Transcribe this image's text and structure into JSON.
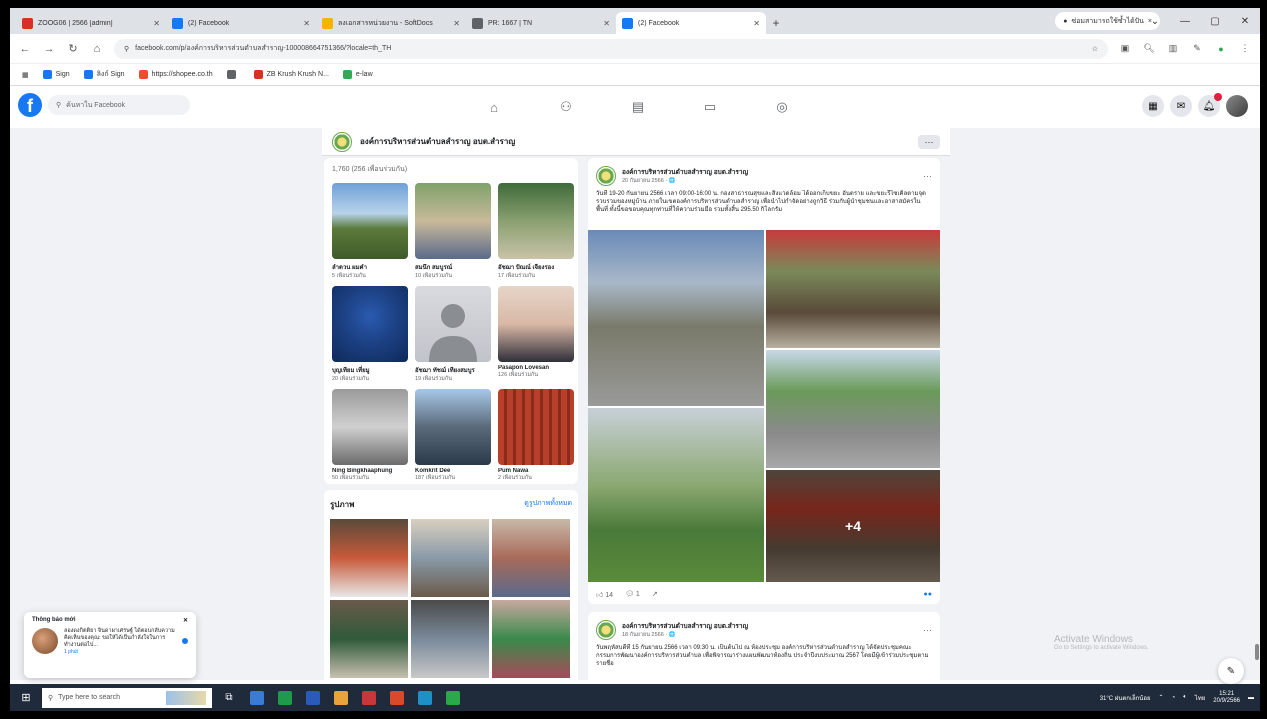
{
  "browser": {
    "tabs": [
      {
        "title": "ZOOG06 | 2566 [admin]",
        "color": "#d93025",
        "active": false
      },
      {
        "title": "(2) Facebook",
        "color": "#1877f2",
        "active": false
      },
      {
        "title": "ลงเอกสารหน่วยงาน - SoftDocs",
        "color": "#f4b400",
        "active": false
      },
      {
        "title": "PR: 1667 | TN",
        "color": "#5f6368",
        "active": false
      },
      {
        "title": "(2) Facebook",
        "color": "#1877f2",
        "active": true
      }
    ],
    "new_tab": "+",
    "profile_pill": "ซ่อมสามารถใช้ซ้ำได้ปัน",
    "url": "facebook.com/p/องค์การบริหารส่วนตำบลสำราญ-100008664751366/?locale=th_TH",
    "bookmarks": [
      {
        "label": "Sign",
        "color": "#1877f2"
      },
      {
        "label": "ลิงก์ Sign",
        "color": "#1877f2"
      },
      {
        "label": "https://shopee.co.th",
        "color": "#ee4d2d"
      },
      {
        "label": "",
        "color": "#5f6368"
      },
      {
        "label": "ZB Krush Krush N...",
        "color": "#d93025"
      },
      {
        "label": "e-law",
        "color": "#34a853"
      }
    ]
  },
  "facebook": {
    "search_placeholder": "ค้นหาใน Facebook",
    "group_name": "องค์การบริหารส่วนตำบลสำราญ อบต.สำราญ",
    "friends_count": "1,760 (256 เพื่อนร่วมกัน)",
    "friends": [
      {
        "name": "ลำดวน ผมคำ",
        "mutual": "5 เพื่อนร่วมกัน",
        "bg": "linear-gradient(180deg,#6fa0d8 0%,#b8d3ea 40%,#5b7a3a 60%,#3f5a2a 100%)"
      },
      {
        "name": "สมนึก สมบูรณ์",
        "mutual": "10 เพื่อนร่วมกัน",
        "bg": "linear-gradient(180deg,#7fa26a 0%,#c9b99a 50%,#5a6a8a 100%)"
      },
      {
        "name": "อัชฌา ปัณณ์ เจียงรอง",
        "mutual": "17 เพื่อนร่วมกัน",
        "bg": "linear-gradient(180deg,#3f6a3a 0%,#8aa070 50%,#c9c3a8 100%)"
      },
      {
        "name": "บุญเทียม เที่ยมู",
        "mutual": "20 เพื่อนร่วมกัน",
        "bg": "radial-gradient(circle at 50% 40%,#2a5ab0 0%,#1b3f80 50%,#0e2a5a 100%)"
      },
      {
        "name": "อัชฌา ทัชฌ์ เทียงสมบูร",
        "mutual": "19 เพื่อนร่วมกัน",
        "bg": "linear-gradient(180deg,#d8dadf 0%,#c0c3c9 100%)"
      },
      {
        "name": "Pasapon Lovesan",
        "mutual": "126 เพื่อนร่วมกัน",
        "bg": "linear-gradient(180deg,#e6d5c8 0%,#d9b8a5 50%,#2f2f3a 100%)"
      },
      {
        "name": "Ning Bingkhaaphung",
        "mutual": "50 เพื่อนร่วมกัน",
        "bg": "linear-gradient(180deg,#9a9a9a 0%,#d0d0d0 50%,#6a6a6a 100%)"
      },
      {
        "name": "Komkrit Dee",
        "mutual": "187 เพื่อนร่วมกัน",
        "bg": "linear-gradient(180deg,#a8c8e8 0%,#5a6a7a 50%,#2a3a4a 100%)"
      },
      {
        "name": "Pum Nawa",
        "mutual": "2 เพื่อนร่วมกัน",
        "bg": "repeating-linear-gradient(90deg,#b8402a 0px,#b8402a 6px,#8a2a1a 6px,#8a2a1a 9px)"
      }
    ],
    "photos_title": "รูปภาพ",
    "photos_link": "ดูรูปภาพทั้งหมด",
    "photos": [
      "linear-gradient(180deg,#5a4a3a,#c85a3a,#e8e8e8)",
      "linear-gradient(180deg,#d8d0c0,#8a9aa8,#6a5a4a)",
      "linear-gradient(180deg,#c8b8a8,#a86a5a,#5a6a8a)",
      "linear-gradient(180deg,#6a5a4a,#2f5a3a,#c8c0b0)",
      "linear-gradient(180deg,#4a4a4a,#7a8a9a,#c8c8c8)",
      "linear-gradient(180deg,#c8a8a0,#3a8a4a,#a84a5a)"
    ],
    "post1": {
      "author": "องค์การบริหารส่วนตำบลสำราญ อบต.สำราญ",
      "date": "20 กันยายน 2566 · 🌐",
      "text": "วันที่ 19-20 กันยายน 2566 เวลา 09:00-16:00 น. กองสาธารณสุขและสิ่งแวดล้อม ได้ออกเก็บขยะ อันตราย และขยะรีไซเคิลตามจุดรวบรวมของหมู่บ้าน ภายในเขตองค์การบริหารส่วนตำบลสำราญ เพื่อนำไปกำจัดอย่างถูกวิธี ร่วมกับผู้นำชุมชนและอาสาสมัครในพื้นที่ ทั้งนี้ขอขอบคุณทุกท่านที่ให้ความร่วมมือ รวมทั้งสิ้น 295.50 กิโลกรัม",
      "more_photos": "+4",
      "likes": "14",
      "comments": "1",
      "photos": [
        "linear-gradient(180deg,#6a8ab8 0%,#a8b8c8 30%,#7a7a6a 55%,#9a9a9a 100%)",
        "linear-gradient(180deg,#c83a3a 0%,#7a8a5a 35%,#5a4a3a 70%,#b8b0a0 100%)",
        "linear-gradient(180deg,#c8d8e8 0%,#6a9a5a 35%,#8a8a8a 70%,#a8a8a8 100%)",
        "linear-gradient(180deg,#c8d0d8 0%,#8aa870 45%,#4a7a3a 70%,#5a8a3a 100%)",
        "linear-gradient(180deg,#7a6a5a 0%,#b83a2a 35%,#6a5a4a 70%,#9a8a7a 100%)"
      ]
    },
    "post2": {
      "author": "องค์การบริหารส่วนตำบลสำราญ อบต.สำราญ",
      "date": "18 กันยายน 2566 · 🌐",
      "text": "วันพฤหัสบดีที่ 15 กันยายน 2566 เวลา 09:30 น. เป็นต้นไป ณ ห้องประชุม องค์การบริหารส่วนตำบลสำราญ ได้จัดประชุมคณะกรรมการพัฒนาองค์การบริหารส่วนตำบล เพื่อพิจารณาร่างแผนพัฒนาท้องถิ่น ประจำปีงบประมาณ 2567 โดยมีผู้เข้าร่วมประชุมตามรายชื่อ"
    },
    "notification": {
      "title": "Thông báo mới",
      "text": "ลองดงกิตติยา จินดาผาเศรษฐ์ ได้ตอบกลับความคิดเห็นของคุณ: ขอให้ได้เป็นกำลังใจในการทำงานต่อไป...",
      "time": "1 phút"
    }
  },
  "windows": {
    "watermark_title": "Activate Windows",
    "watermark_sub": "Go to Settings to activate Windows.",
    "search_placeholder": "Type here to search",
    "weather": "31°C ฝนตกเล็กน้อย",
    "time": "15:21",
    "date": "20/9/2566",
    "lang": "ไทย",
    "apps": [
      "#3a7bd5",
      "#1f9a4a",
      "#2b5bb8",
      "#e8a33a",
      "#c8383a",
      "#d84a2a",
      "#1e90c8",
      "#2aa84a"
    ]
  }
}
